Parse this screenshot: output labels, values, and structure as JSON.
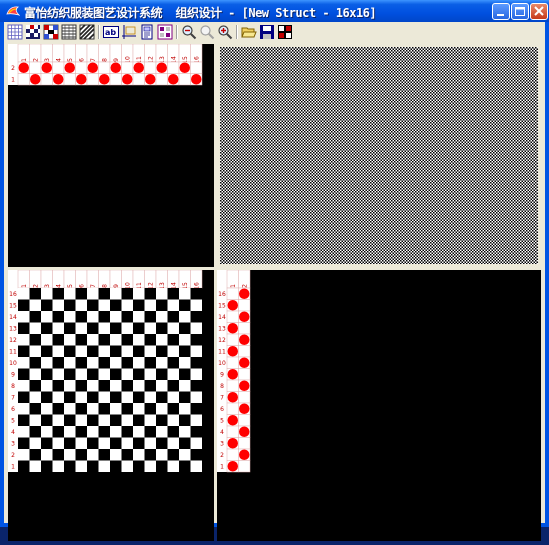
{
  "window": {
    "title": "富怡纺织服装图艺设计系统  组织设计 - [New Struct - 16x16]",
    "title_color": "#ffffff",
    "titlebar_color": "#0054e3"
  },
  "title_buttons": [
    "minimize-icon",
    "maximize-icon",
    "close-icon"
  ],
  "toolbar": {
    "icons": [
      "grid-icon",
      "pattern-fill-icon",
      "color-pattern-icon",
      "hatch-icon",
      "diagonal-stripe-icon",
      "text-label-icon",
      "cross-grid-icon",
      "print-preview-icon",
      "thumbnail-icon",
      "zoom-out-icon",
      "zoom-reset-icon",
      "zoom-in-icon",
      "open-file-icon",
      "save-file-icon",
      "color-palette-icon"
    ]
  },
  "weave": {
    "size": "16x16",
    "columns": [
      "1",
      "2",
      "3",
      "4",
      "5",
      "6",
      "7",
      "8",
      "9",
      "10",
      "11",
      "12",
      "13",
      "14",
      "15",
      "16"
    ],
    "rows": [
      "16",
      "15",
      "14",
      "13",
      "12",
      "11",
      "10",
      "9",
      "8",
      "7",
      "6",
      "5",
      "4",
      "3",
      "2",
      "1"
    ],
    "treadle_rows": [
      "2",
      "1"
    ],
    "threading_columns": [
      "1",
      "2"
    ],
    "marker_color": "#ff0000",
    "label_color": "#c00000"
  }
}
